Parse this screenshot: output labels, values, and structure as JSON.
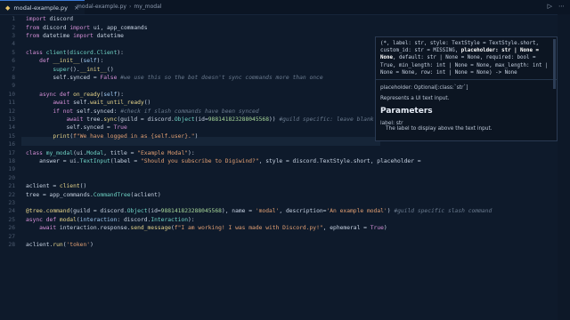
{
  "tab": {
    "icon": "python-icon",
    "label": "modal-example.py",
    "close": "×"
  },
  "breadcrumb": {
    "file": "modal-example.py",
    "sep": "›",
    "symbol": "my_modal"
  },
  "actions": {
    "run": "▷",
    "more": "⋯"
  },
  "lines": [
    {
      "n": "1",
      "tokens": [
        {
          "t": "kw",
          "v": "import "
        },
        {
          "t": "code",
          "v": "discord"
        }
      ]
    },
    {
      "n": "2",
      "tokens": [
        {
          "t": "kw",
          "v": "from "
        },
        {
          "t": "code",
          "v": "discord "
        },
        {
          "t": "kw",
          "v": "import "
        },
        {
          "t": "code",
          "v": "ui, app_commands"
        }
      ]
    },
    {
      "n": "3",
      "tokens": [
        {
          "t": "kw",
          "v": "from "
        },
        {
          "t": "code",
          "v": "datetime "
        },
        {
          "t": "kw",
          "v": "import "
        },
        {
          "t": "code",
          "v": "datetime"
        }
      ]
    },
    {
      "n": "4",
      "tokens": []
    },
    {
      "n": "5",
      "tokens": [
        {
          "t": "kw",
          "v": "class "
        },
        {
          "t": "cls",
          "v": "client"
        },
        {
          "t": "code",
          "v": "("
        },
        {
          "t": "cls",
          "v": "discord.Client"
        },
        {
          "t": "code",
          "v": "):"
        }
      ]
    },
    {
      "n": "6",
      "tokens": [
        {
          "t": "code",
          "v": "    "
        },
        {
          "t": "kw",
          "v": "def "
        },
        {
          "t": "fn",
          "v": "__init__"
        },
        {
          "t": "code",
          "v": "("
        },
        {
          "t": "par",
          "v": "self"
        },
        {
          "t": "code",
          "v": "):"
        }
      ]
    },
    {
      "n": "7",
      "tokens": [
        {
          "t": "code",
          "v": "        "
        },
        {
          "t": "cls",
          "v": "super"
        },
        {
          "t": "code",
          "v": "()."
        },
        {
          "t": "fn",
          "v": "__init__"
        },
        {
          "t": "code",
          "v": "()"
        }
      ]
    },
    {
      "n": "8",
      "tokens": [
        {
          "t": "code",
          "v": "        self.synced = "
        },
        {
          "t": "kw",
          "v": "False "
        },
        {
          "t": "cmt",
          "v": "#we use this so the bot doesn't sync commands more than once"
        }
      ]
    },
    {
      "n": "9",
      "tokens": []
    },
    {
      "n": "10",
      "tokens": [
        {
          "t": "code",
          "v": "    "
        },
        {
          "t": "kw",
          "v": "async def "
        },
        {
          "t": "fn",
          "v": "on_ready"
        },
        {
          "t": "code",
          "v": "("
        },
        {
          "t": "par",
          "v": "self"
        },
        {
          "t": "code",
          "v": "):"
        }
      ]
    },
    {
      "n": "11",
      "tokens": [
        {
          "t": "code",
          "v": "        "
        },
        {
          "t": "kw",
          "v": "await "
        },
        {
          "t": "code",
          "v": "self."
        },
        {
          "t": "fn",
          "v": "wait_until_ready"
        },
        {
          "t": "code",
          "v": "()"
        }
      ]
    },
    {
      "n": "12",
      "tokens": [
        {
          "t": "code",
          "v": "        "
        },
        {
          "t": "kw",
          "v": "if not "
        },
        {
          "t": "code",
          "v": "self.synced: "
        },
        {
          "t": "cmt",
          "v": "#check if slash commands have been synced"
        }
      ]
    },
    {
      "n": "13",
      "tokens": [
        {
          "t": "code",
          "v": "            "
        },
        {
          "t": "kw",
          "v": "await "
        },
        {
          "t": "code",
          "v": "tree."
        },
        {
          "t": "fn",
          "v": "sync"
        },
        {
          "t": "code",
          "v": "(guild = discord."
        },
        {
          "t": "cls",
          "v": "Object"
        },
        {
          "t": "code",
          "v": "(id="
        },
        {
          "t": "num",
          "v": "988141823288045568"
        },
        {
          "t": "code",
          "v": ")) "
        },
        {
          "t": "cmt",
          "v": "#guild specific: leave blank if global (glo"
        }
      ]
    },
    {
      "n": "14",
      "tokens": [
        {
          "t": "code",
          "v": "            self.synced = "
        },
        {
          "t": "kw",
          "v": "True"
        }
      ]
    },
    {
      "n": "15",
      "tokens": [
        {
          "t": "code",
          "v": "        "
        },
        {
          "t": "fn",
          "v": "print"
        },
        {
          "t": "code",
          "v": "("
        },
        {
          "t": "str",
          "v": "f\"We have logged in as {self.user}.\""
        },
        {
          "t": "code",
          "v": ")"
        }
      ]
    },
    {
      "n": "16",
      "tokens": []
    },
    {
      "n": "17",
      "tokens": [
        {
          "t": "kw",
          "v": "class "
        },
        {
          "t": "cls",
          "v": "my_modal"
        },
        {
          "t": "code",
          "v": "(ui."
        },
        {
          "t": "cls",
          "v": "Modal"
        },
        {
          "t": "code",
          "v": ", title = "
        },
        {
          "t": "str",
          "v": "\"Example Modal\""
        },
        {
          "t": "code",
          "v": "):"
        }
      ]
    },
    {
      "n": "18",
      "tokens": [
        {
          "t": "code",
          "v": "    answer = ui."
        },
        {
          "t": "cls",
          "v": "TextInput"
        },
        {
          "t": "code",
          "v": "(label = "
        },
        {
          "t": "str",
          "v": "\"Should you subscribe to Digiwind?\""
        },
        {
          "t": "code",
          "v": ", style = discord.TextStyle.short, placeholder = "
        }
      ]
    },
    {
      "n": "19",
      "tokens": []
    },
    {
      "n": "20",
      "tokens": []
    },
    {
      "n": "21",
      "tokens": [
        {
          "t": "code",
          "v": "aclient = "
        },
        {
          "t": "fn",
          "v": "client"
        },
        {
          "t": "code",
          "v": "()"
        }
      ]
    },
    {
      "n": "22",
      "tokens": [
        {
          "t": "code",
          "v": "tree = app_commands."
        },
        {
          "t": "cls",
          "v": "CommandTree"
        },
        {
          "t": "code",
          "v": "(aclient)"
        }
      ]
    },
    {
      "n": "23",
      "tokens": []
    },
    {
      "n": "24",
      "tokens": [
        {
          "t": "fn",
          "v": "@tree.command"
        },
        {
          "t": "code",
          "v": "(guild = discord."
        },
        {
          "t": "cls",
          "v": "Object"
        },
        {
          "t": "code",
          "v": "(id="
        },
        {
          "t": "num",
          "v": "988141823288045568"
        },
        {
          "t": "code",
          "v": "), name = "
        },
        {
          "t": "str",
          "v": "'modal'"
        },
        {
          "t": "code",
          "v": ", description="
        },
        {
          "t": "str",
          "v": "'An example modal'"
        },
        {
          "t": "code",
          "v": ") "
        },
        {
          "t": "cmt",
          "v": "#guild specific slash command"
        }
      ]
    },
    {
      "n": "25",
      "tokens": [
        {
          "t": "kw",
          "v": "async def "
        },
        {
          "t": "fn",
          "v": "modal"
        },
        {
          "t": "code",
          "v": "("
        },
        {
          "t": "par",
          "v": "interaction"
        },
        {
          "t": "code",
          "v": ": discord."
        },
        {
          "t": "cls",
          "v": "Interaction"
        },
        {
          "t": "code",
          "v": "):"
        }
      ]
    },
    {
      "n": "26",
      "tokens": [
        {
          "t": "code",
          "v": "    "
        },
        {
          "t": "kw",
          "v": "await "
        },
        {
          "t": "code",
          "v": "interaction.response."
        },
        {
          "t": "fn",
          "v": "send_message"
        },
        {
          "t": "code",
          "v": "("
        },
        {
          "t": "str",
          "v": "f\"I am working! I was made with Discord.py!\""
        },
        {
          "t": "code",
          "v": ", ephemeral = "
        },
        {
          "t": "kw",
          "v": "True"
        },
        {
          "t": "code",
          "v": ")"
        }
      ]
    },
    {
      "n": "27",
      "tokens": []
    },
    {
      "n": "28",
      "tokens": [
        {
          "t": "code",
          "v": "aclient."
        },
        {
          "t": "fn",
          "v": "run"
        },
        {
          "t": "code",
          "v": "("
        },
        {
          "t": "str",
          "v": "'token'"
        },
        {
          "t": "code",
          "v": ")"
        }
      ]
    }
  ],
  "hover": {
    "signature_pre": "(*, label: str, style: TextStyle = TextStyle.short, custom_id: str = MISSING, ",
    "signature_bold": "placeholder: str | None = None",
    "signature_post": ", default: str | None = None, required: bool = True, min_length: int | None = None, max_length: int | None = None, row: int | None = None) -> None",
    "param_line": "placeholder: Optional[:class:`str`]",
    "desc": "Represents a UI text input.",
    "heading": "Parameters",
    "param_label": "label: str",
    "param_label_desc": "The label to display above the text input."
  }
}
